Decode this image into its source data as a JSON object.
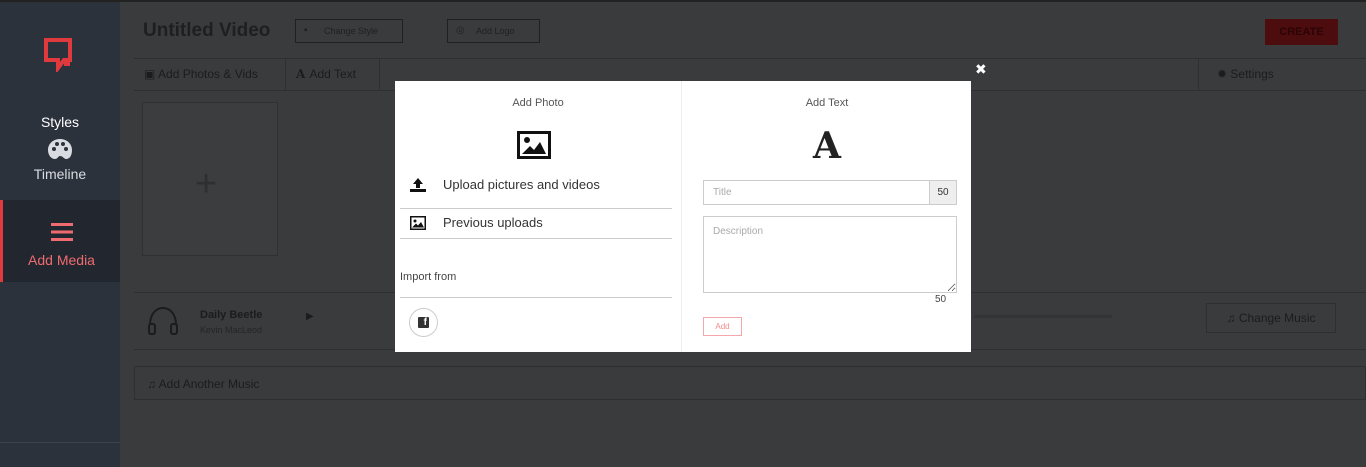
{
  "sidebar": {
    "styles_label": "Styles",
    "timeline_label": "Timeline",
    "add_media_label": "Add Media",
    "accent": "#e0393e"
  },
  "header": {
    "video_title": "Untitled Video",
    "change_style_label": "Change Style",
    "add_logo_label": "Add Logo",
    "create_label": "CREATE"
  },
  "tabs": {
    "add_photos_label": "Add Photos & Vids",
    "add_text_label": "Add Text",
    "settings_label": "Settings"
  },
  "music": {
    "title": "Daily Beetle",
    "artist": "Kevin MacLeod",
    "change_music_label": "Change Music",
    "add_another_label": "Add Another Music"
  },
  "modal": {
    "add_photo_heading": "Add Photo",
    "upload_label": "Upload pictures and videos",
    "previous_uploads_label": "Previous uploads",
    "import_from_label": "Import from",
    "add_text_heading": "Add Text",
    "text_glyph": "A",
    "title_placeholder": "Title",
    "title_count": "50",
    "description_placeholder": "Description",
    "description_count": "50",
    "add_button_label": "Add",
    "close_glyph": "✖"
  }
}
